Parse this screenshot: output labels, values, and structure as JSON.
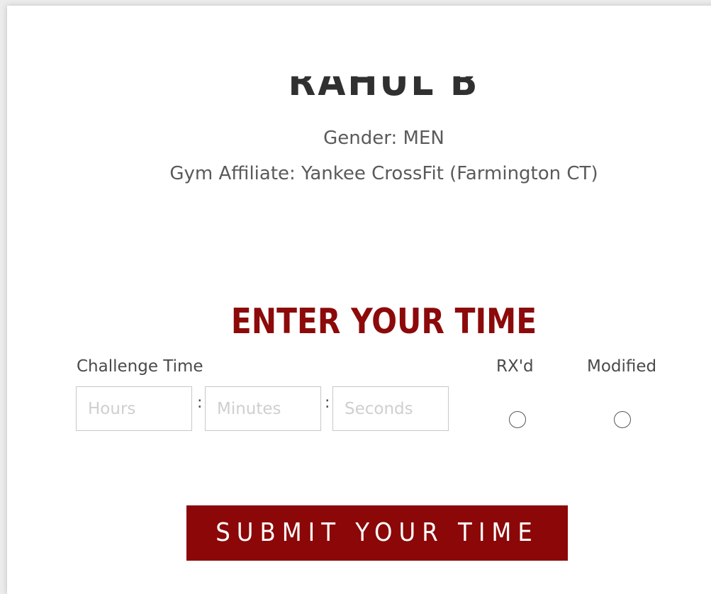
{
  "athlete": {
    "name": "RAHUL B",
    "gender_line": "Gender: MEN",
    "gym_line": "Gym Affiliate: Yankee CrossFit (Farmington CT)"
  },
  "time_entry": {
    "title": "ENTER YOUR TIME",
    "challenge_label": "Challenge Time",
    "hours_placeholder": "Hours",
    "minutes_placeholder": "Minutes",
    "seconds_placeholder": "Seconds",
    "separator": ":",
    "rxd_label": "RX'd",
    "modified_label": "Modified",
    "rxd_selected": false,
    "modified_selected": false
  },
  "submit": {
    "label": "SUBMIT YOUR TIME"
  },
  "colors": {
    "accent": "#8c0707",
    "title": "#8c0a0a",
    "text": "#5a5a5a"
  }
}
